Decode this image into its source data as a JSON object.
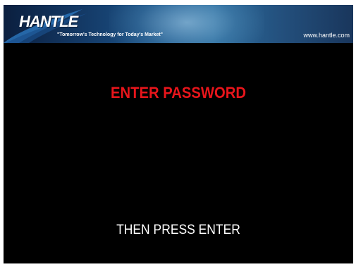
{
  "banner": {
    "logo_text": "HANTLE",
    "tagline": "\"Tomorrow's Technology for Today's Market\"",
    "website": "www.hantle.com",
    "colors": {
      "banner_dark": "#0b1f3f",
      "banner_mid": "#1f5a8e"
    }
  },
  "main": {
    "password_prompt": "ENTER PASSWORD",
    "enter_prompt": "THEN PRESS ENTER",
    "colors": {
      "background": "#000000",
      "password_prompt": "#e8151b",
      "enter_prompt": "#ffffff"
    }
  }
}
